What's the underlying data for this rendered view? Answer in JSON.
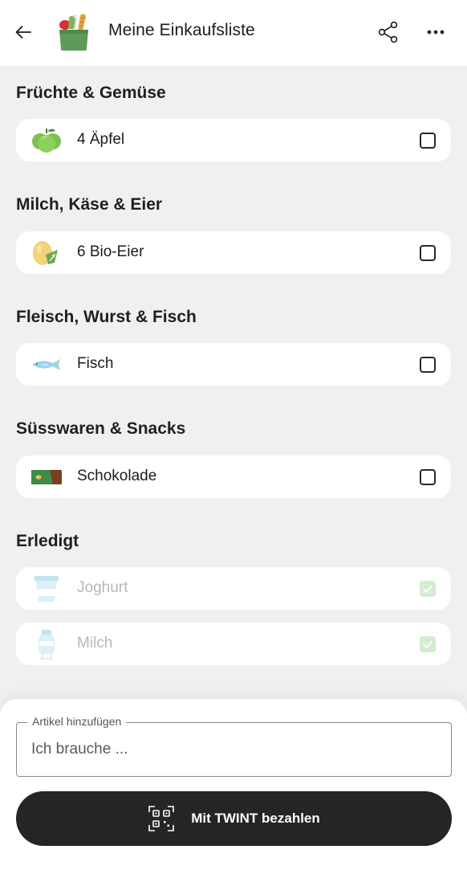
{
  "header": {
    "title": "Meine Einkaufsliste",
    "back_icon": "arrow-left-icon",
    "share_icon": "share-icon",
    "more_icon": "more-horizontal-icon"
  },
  "sections": [
    {
      "title": "Früchte & Gemüse",
      "items": [
        {
          "label": "4 Äpfel",
          "icon": "apple-icon",
          "checked": false
        }
      ]
    },
    {
      "title": "Milch, Käse & Eier",
      "items": [
        {
          "label": "6 Bio-Eier",
          "icon": "egg-icon",
          "checked": false
        }
      ]
    },
    {
      "title": "Fleisch, Wurst & Fisch",
      "items": [
        {
          "label": "Fisch",
          "icon": "fish-icon",
          "checked": false
        }
      ]
    },
    {
      "title": "Süsswaren & Snacks",
      "items": [
        {
          "label": "Schokolade",
          "icon": "chocolate-icon",
          "checked": false
        }
      ]
    },
    {
      "title": "Erledigt",
      "items": [
        {
          "label": "Joghurt",
          "icon": "yogurt-icon",
          "checked": true
        },
        {
          "label": "Milch",
          "icon": "milk-icon",
          "checked": true
        }
      ]
    }
  ],
  "add_item": {
    "legend": "Artikel hinzufügen",
    "placeholder": "Ich brauche ..."
  },
  "pay_button": {
    "label": "Mit TWINT bezahlen",
    "icon": "qr-code-icon"
  },
  "colors": {
    "background": "#f0f0f0",
    "card": "#ffffff",
    "button": "#252525",
    "checked": "#d4ecd0"
  }
}
